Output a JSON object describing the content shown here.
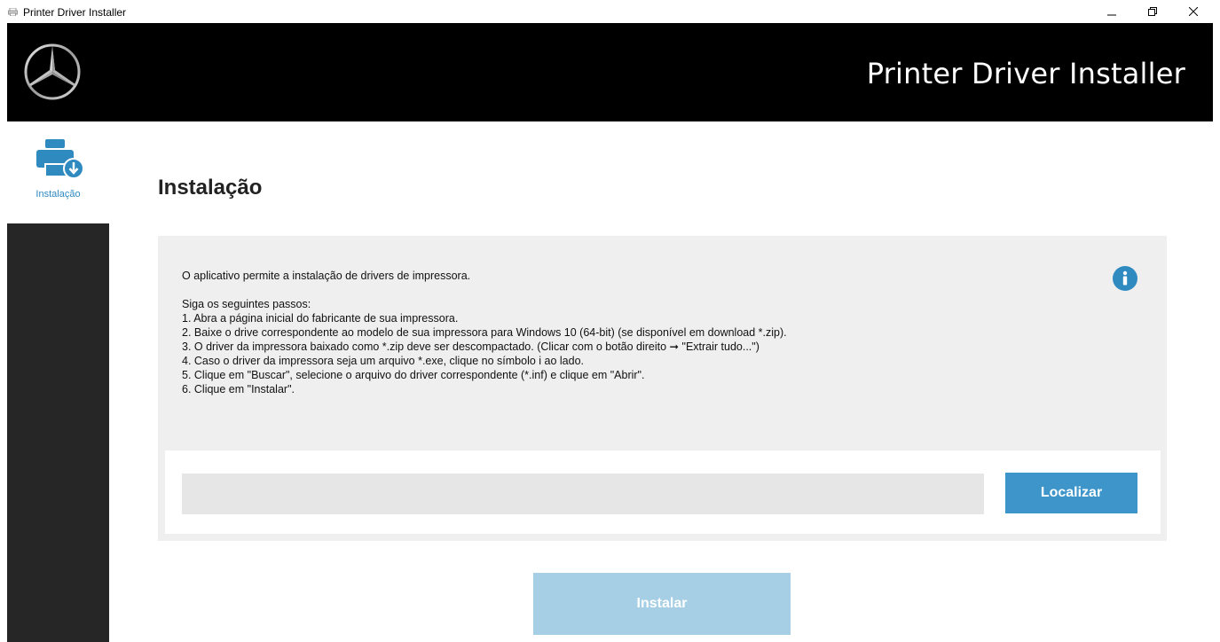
{
  "window": {
    "title": "Printer Driver Installer",
    "icons": {
      "app": "printer-icon",
      "minimize": "minimize-icon",
      "maximize": "restore-icon",
      "close": "close-icon"
    }
  },
  "header": {
    "logo_icon": "mercedes-star-icon",
    "title": "Printer Driver Installer"
  },
  "sidebar": {
    "items": [
      {
        "label": "Instalação",
        "icon": "printer-download-icon",
        "active": true
      }
    ]
  },
  "main": {
    "page_title": "Instalação",
    "info": {
      "intro": "O aplicativo permite a instalação de drivers de impressora.",
      "steps_heading": "Siga os seguintes passos:",
      "steps": [
        "1. Abra a página inicial do fabricante de sua impressora.",
        "2. Baixe o drive correspondente ao modelo de sua impressora para Windows 10 (64-bit) (se disponível em download *.zip).",
        "3. O driver da impressora baixado como *.zip deve ser descompactado. (Clicar com o botão direito ➞ \"Extrair tudo...\")",
        "4. Caso o driver da impressora seja um arquivo *.exe, clique no símbolo i ao lado.",
        "5. Clique em \"Buscar\", selecione o arquivo do driver correspondente (*.inf) e clique em \"Abrir\".",
        "6. Clique em \"Instalar\"."
      ],
      "icon": "info-icon"
    },
    "file_path": {
      "value": "",
      "placeholder": ""
    },
    "locate_button": "Localizar",
    "install_button": "Instalar"
  },
  "colors": {
    "header_bg": "#000000",
    "accent": "#3d95c9",
    "accent_disabled": "#a6cfe6",
    "sidebar_dark": "#262626",
    "panel_bg": "#efefef"
  }
}
